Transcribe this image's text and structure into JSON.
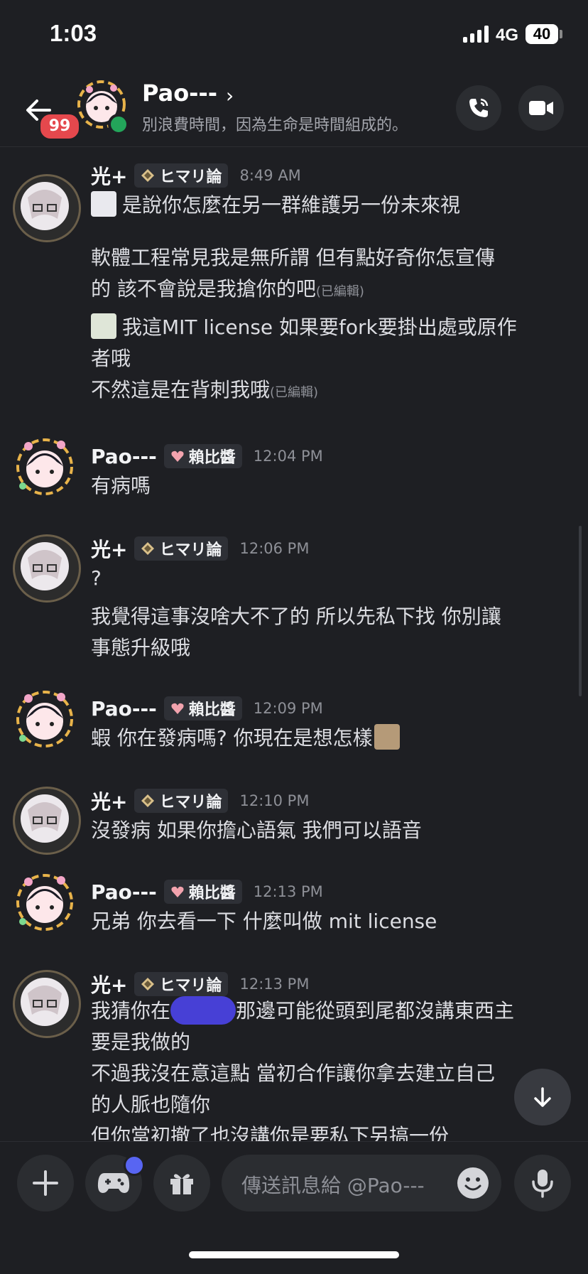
{
  "status_bar": {
    "time": "1:03",
    "network": "4G",
    "battery": "40"
  },
  "header": {
    "unread_badge": "99",
    "name": "Pao---",
    "chevron": "›",
    "status_text": "別浪費時間，因為生命是時間組成的。"
  },
  "messages": [
    {
      "author": "光+",
      "role": "ヒマリ論",
      "time": "8:49 AM",
      "lines": [
        "是說你怎麼在另一群維護另一份未來視",
        "軟體工程常見我是無所謂 但有點好奇你怎宣傳",
        "的 該不會說是我搶你的吧",
        "我這MIT license 如果要fork要掛出處或原作",
        "者哦",
        "不然這是在背刺我哦"
      ],
      "edited": "(已編輯)"
    },
    {
      "author": "Pao---",
      "role": "賴比醬",
      "time": "12:04 PM",
      "lines": [
        "有病嗎"
      ]
    },
    {
      "author": "光+",
      "role": "ヒマリ論",
      "time": "12:06 PM",
      "lines": [
        "?",
        "我覺得這事沒啥大不了的 所以先私下找 你別讓",
        "事態升級哦"
      ]
    },
    {
      "author": "Pao---",
      "role": "賴比醬",
      "time": "12:09 PM",
      "lines": [
        "蝦 你在發病嗎? 你現在是想怎樣"
      ]
    },
    {
      "author": "光+",
      "role": "ヒマリ論",
      "time": "12:10 PM",
      "lines": [
        "沒發病 如果你擔心語氣 我們可以語音"
      ]
    },
    {
      "author": "Pao---",
      "role": "賴比醬",
      "time": "12:13 PM",
      "lines": [
        "兄弟 你去看一下 什麼叫做 mit license"
      ]
    },
    {
      "author": "光+",
      "role": "ヒマリ論",
      "time": "12:13 PM",
      "lines": [
        "我猜你在",
        "那邊可能從頭到尾都沒講東西主",
        "要是我做的",
        "不過我沒在意這點 當初合作讓你拿去建立自己",
        "的人脈也隨你",
        "但你當初撤了也沒講你是要私下另搞一份"
      ]
    }
  ],
  "composer": {
    "placeholder": "傳送訊息給 @Pao---"
  },
  "colors": {
    "background": "#1e1f23",
    "accent": "#5865f2",
    "badge": "#e5484d",
    "online": "#23a55a",
    "redaction": "#4740d6"
  },
  "icons": [
    "back-arrow-icon",
    "phone-icon",
    "video-icon",
    "plus-icon",
    "gamepad-icon",
    "gift-icon",
    "emoji-icon",
    "mic-icon",
    "arrow-down-icon",
    "role-diamond-icon",
    "heart-icon"
  ]
}
